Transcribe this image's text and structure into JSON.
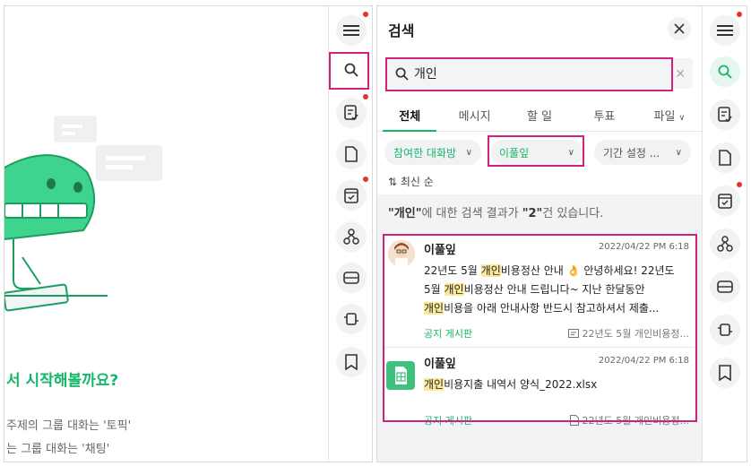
{
  "left": {
    "hero_title": "서 시작해볼까요?",
    "hero_line1": "주제의 그룹 대화는 '토픽'",
    "hero_line2": "는 그룹 대화는 '채팅'"
  },
  "rail": {
    "items": [
      {
        "icon": "menu-icon",
        "badge": true
      },
      {
        "icon": "search-icon",
        "badge": false
      },
      {
        "icon": "task-icon",
        "badge": true
      },
      {
        "icon": "file-icon",
        "badge": false
      },
      {
        "icon": "calendar-check-icon",
        "badge": true
      },
      {
        "icon": "org-chart-icon",
        "badge": false
      },
      {
        "icon": "drive-icon",
        "badge": false
      },
      {
        "icon": "integration-icon",
        "badge": false
      },
      {
        "icon": "bookmark-icon",
        "badge": false
      }
    ]
  },
  "search": {
    "title": "검색",
    "query": "개인",
    "tabs": [
      "전체",
      "메시지",
      "할 일",
      "투표",
      "파일"
    ],
    "active_tab": "전체",
    "filters": {
      "room": "참여한 대화방",
      "person": "이풀잎",
      "period": "기간 설정 ..."
    },
    "sort": "최신 순",
    "summary": {
      "keyword": "\"개인\"",
      "middle": "에 대한 검색 결과가 ",
      "count": "\"2\"",
      "suffix": "건 있습니다."
    },
    "results": [
      {
        "author": "이풀잎",
        "date": "2022/04/22 PM 6:18",
        "board": "공지 게시판",
        "source": "22년도 5월 개인비용정..."
      },
      {
        "author": "이풀잎",
        "date": "2022/04/22 PM 6:18",
        "file_hl": "개인",
        "file_rest": "비용지출 내역서 양식_2022.xlsx",
        "board": "공지 게시판",
        "source": "22년도 5월 개인비용정..."
      }
    ],
    "r1": {
      "l1a": "22년도 5월 ",
      "l1hl": "개인",
      "l1b": "비용정산 안내 ",
      "l1c": " 안녕하세요! 22년도",
      "l2a": "5월 ",
      "l2hl": "개인",
      "l2b": "비용정산 안내 드립니다~ 지난 한달동안",
      "l3hl": "개인",
      "l3b": "비용을 아래 안내사항 반드시 참고하셔서 제출..."
    }
  },
  "colors": {
    "accent": "#15b76a",
    "highlight_box": "#d3207f",
    "badge": "#e5322d"
  }
}
